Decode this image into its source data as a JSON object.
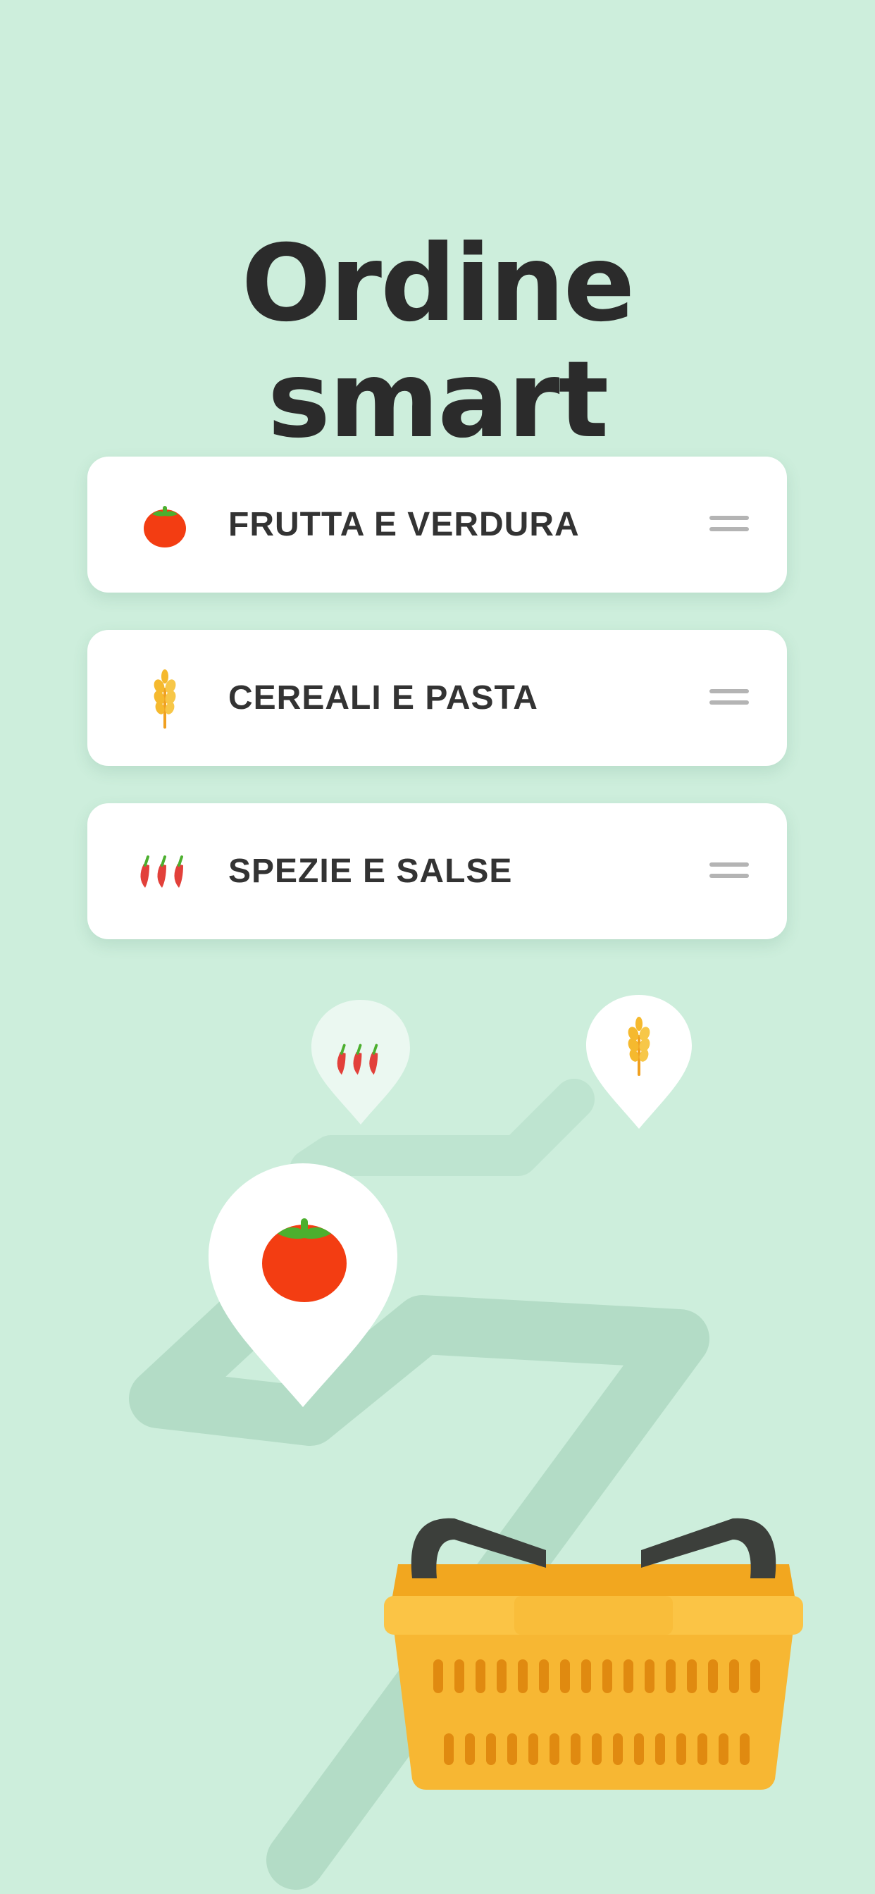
{
  "title": {
    "line1": "Ordine",
    "line2": "smart"
  },
  "categories": [
    {
      "label": "FRUTTA E VERDURA",
      "icon": "tomato-icon"
    },
    {
      "label": "CEREALI E PASTA",
      "icon": "wheat-icon"
    },
    {
      "label": "SPEZIE E SALSE",
      "icon": "chili-peppers-icon"
    }
  ],
  "map_pins": [
    {
      "icon": "chili-peppers-icon"
    },
    {
      "icon": "wheat-icon"
    },
    {
      "icon": "tomato-icon"
    }
  ],
  "illustration": "shopping-basket",
  "colors": {
    "background": "#cdeedc",
    "path": "#b3dcc6",
    "title": "#2b2b2b",
    "card": "#ffffff",
    "tomato": "#f33d12",
    "leaf": "#4caf2e",
    "wheat": "#f5b92e",
    "chili": "#e2403a",
    "basket": "#f7b733",
    "handle": "#3c3f3b"
  }
}
